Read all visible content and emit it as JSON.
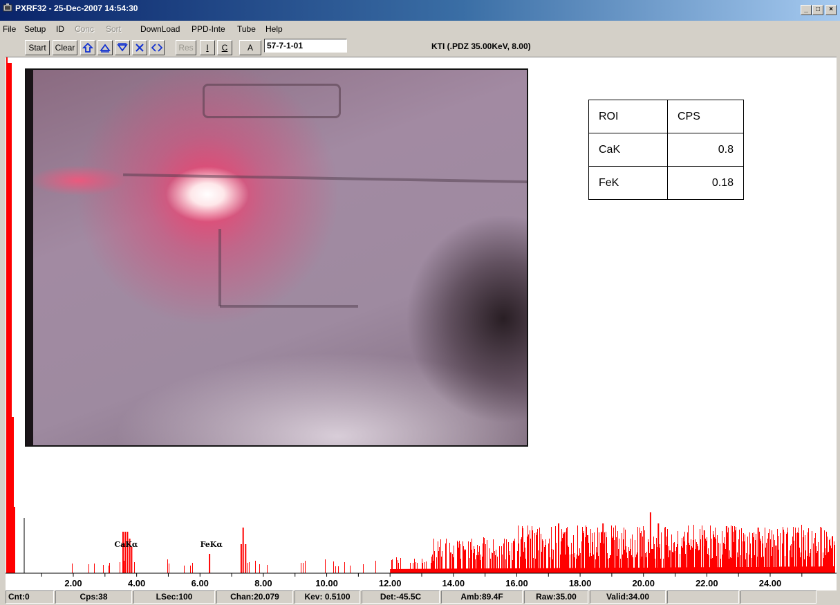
{
  "window": {
    "title": "PXRF32 - 25-Dec-2007 14:54:30",
    "controls": {
      "minimize": "_",
      "maximize": "□",
      "close": "×"
    }
  },
  "menu": [
    {
      "label": "File",
      "enabled": true
    },
    {
      "label": "Setup",
      "enabled": true
    },
    {
      "label": "ID",
      "enabled": true
    },
    {
      "label": "Conc",
      "enabled": false
    },
    {
      "label": "Sort",
      "enabled": false
    },
    {
      "label": "DownLoad",
      "enabled": true
    },
    {
      "label": "PPD-Inte",
      "enabled": true
    },
    {
      "label": "Tube",
      "enabled": true
    },
    {
      "label": "Help",
      "enabled": true
    }
  ],
  "toolbar": {
    "start_label": "Start",
    "clear_label": "Clear",
    "icons": [
      "marker-up-icon",
      "triangle-up-icon",
      "triangle-down-icon",
      "cross-icon",
      "diamond-icon"
    ],
    "res_label": "Res",
    "i_label": "I",
    "c_label": "C",
    "a_label": "A",
    "sample_id": "57-7-1-01",
    "config": "KTI  (.PDZ 35.00KeV, 8.00)"
  },
  "roi_table": {
    "headers": [
      "ROI",
      "CPS"
    ],
    "rows": [
      {
        "roi": "CaK",
        "cps": "0.8"
      },
      {
        "roi": "FeK",
        "cps": "0.18"
      }
    ]
  },
  "spectrum": {
    "x_ticks": [
      "2.00",
      "4.00",
      "6.00",
      "8.00",
      "10.00",
      "12.00",
      "14.00",
      "16.00",
      "18.00",
      "20.00",
      "22.00",
      "24.00"
    ],
    "peak_labels": [
      {
        "text": "CaKα",
        "kev": 3.69
      },
      {
        "text": "FeKα",
        "kev": 6.4
      }
    ],
    "color": "#ff0000"
  },
  "status": {
    "cnt": "Cnt:0",
    "cps": "Cps:38",
    "lsec": "LSec:100",
    "chan": "Chan:20.079",
    "kev": "Kev: 0.5100",
    "det": "Det:-45.5C",
    "amb": "Amb:89.4F",
    "raw": "Raw:35.00",
    "valid": "Valid:34.00"
  }
}
